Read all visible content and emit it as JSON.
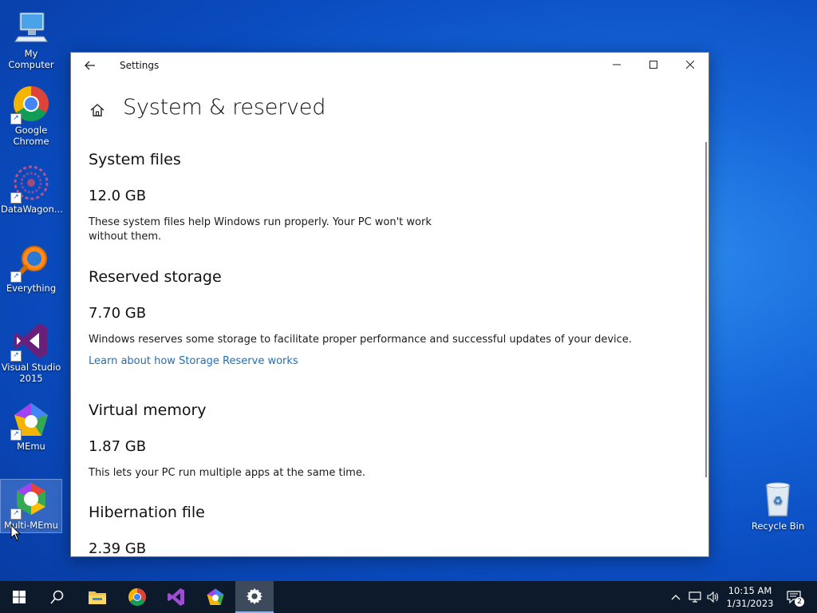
{
  "desktop": {
    "icons": [
      {
        "label": "My Computer"
      },
      {
        "label": "Google Chrome"
      },
      {
        "label": "DataWagon..."
      },
      {
        "label": "Everything"
      },
      {
        "label": "Visual Studio 2015"
      },
      {
        "label": "MEmu"
      },
      {
        "label": "Multi-MEmu"
      },
      {
        "label": "Recycle Bin"
      }
    ]
  },
  "window": {
    "title": "Settings",
    "page_title": "System & reserved",
    "sections": [
      {
        "heading": "System files",
        "size": "12.0 GB",
        "description": "These system files help Windows run properly. Your PC won't work without them."
      },
      {
        "heading": "Reserved storage",
        "size": "7.70 GB",
        "description": "Windows reserves some storage to facilitate proper performance and successful updates of your device.",
        "link": "Learn about how Storage Reserve works"
      },
      {
        "heading": "Virtual memory",
        "size": "1.87 GB",
        "description": "This lets your PC run multiple apps at the same time."
      },
      {
        "heading": "Hibernation file",
        "size": "2.39 GB"
      }
    ]
  },
  "taskbar": {
    "clock_time": "10:15 AM",
    "clock_date": "1/31/2023",
    "notification_count": "2"
  },
  "colors": {
    "link": "#1e6fb6",
    "taskbar": "#0d1a2b",
    "desktop": "#0a4cc0"
  }
}
